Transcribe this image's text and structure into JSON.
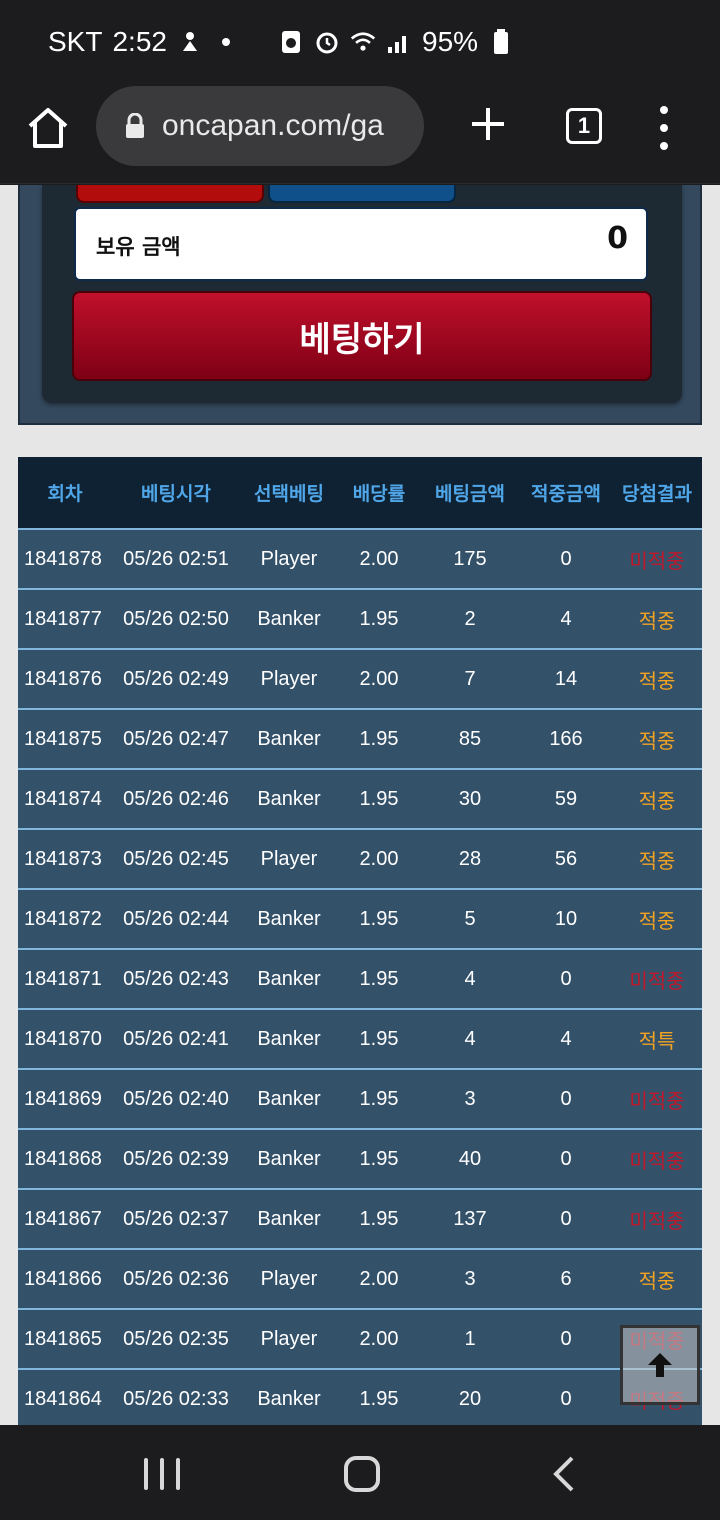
{
  "status_bar": {
    "carrier": "SKT",
    "time": "2:52",
    "battery": "95%"
  },
  "browser": {
    "url": "oncapan.com/ga",
    "tab_count": "1"
  },
  "bet_panel": {
    "balance_label": "보유 금액",
    "balance_value": "0",
    "bet_button_label": "베팅하기"
  },
  "history": {
    "headers": [
      "회차",
      "베팅시각",
      "선택베팅",
      "배당률",
      "베팅금액",
      "적중금액",
      "당첨결과"
    ],
    "rows": [
      {
        "round": "1841878",
        "time": "05/26 02:51",
        "pick": "Player",
        "odds": "2.00",
        "bet": "175",
        "win": "0",
        "result": "미적중",
        "status": "lose"
      },
      {
        "round": "1841877",
        "time": "05/26 02:50",
        "pick": "Banker",
        "odds": "1.95",
        "bet": "2",
        "win": "4",
        "result": "적중",
        "status": "win"
      },
      {
        "round": "1841876",
        "time": "05/26 02:49",
        "pick": "Player",
        "odds": "2.00",
        "bet": "7",
        "win": "14",
        "result": "적중",
        "status": "win"
      },
      {
        "round": "1841875",
        "time": "05/26 02:47",
        "pick": "Banker",
        "odds": "1.95",
        "bet": "85",
        "win": "166",
        "result": "적중",
        "status": "win"
      },
      {
        "round": "1841874",
        "time": "05/26 02:46",
        "pick": "Banker",
        "odds": "1.95",
        "bet": "30",
        "win": "59",
        "result": "적중",
        "status": "win"
      },
      {
        "round": "1841873",
        "time": "05/26 02:45",
        "pick": "Player",
        "odds": "2.00",
        "bet": "28",
        "win": "56",
        "result": "적중",
        "status": "win"
      },
      {
        "round": "1841872",
        "time": "05/26 02:44",
        "pick": "Banker",
        "odds": "1.95",
        "bet": "5",
        "win": "10",
        "result": "적중",
        "status": "win"
      },
      {
        "round": "1841871",
        "time": "05/26 02:43",
        "pick": "Banker",
        "odds": "1.95",
        "bet": "4",
        "win": "0",
        "result": "미적중",
        "status": "lose"
      },
      {
        "round": "1841870",
        "time": "05/26 02:41",
        "pick": "Banker",
        "odds": "1.95",
        "bet": "4",
        "win": "4",
        "result": "적특",
        "status": "win"
      },
      {
        "round": "1841869",
        "time": "05/26 02:40",
        "pick": "Banker",
        "odds": "1.95",
        "bet": "3",
        "win": "0",
        "result": "미적중",
        "status": "lose"
      },
      {
        "round": "1841868",
        "time": "05/26 02:39",
        "pick": "Banker",
        "odds": "1.95",
        "bet": "40",
        "win": "0",
        "result": "미적중",
        "status": "lose"
      },
      {
        "round": "1841867",
        "time": "05/26 02:37",
        "pick": "Banker",
        "odds": "1.95",
        "bet": "137",
        "win": "0",
        "result": "미적중",
        "status": "lose"
      },
      {
        "round": "1841866",
        "time": "05/26 02:36",
        "pick": "Player",
        "odds": "2.00",
        "bet": "3",
        "win": "6",
        "result": "적중",
        "status": "win"
      },
      {
        "round": "1841865",
        "time": "05/26 02:35",
        "pick": "Player",
        "odds": "2.00",
        "bet": "1",
        "win": "0",
        "result": "미적중",
        "status": "lose"
      },
      {
        "round": "1841864",
        "time": "05/26 02:33",
        "pick": "Banker",
        "odds": "1.95",
        "bet": "20",
        "win": "0",
        "result": "미적중",
        "status": "lose"
      }
    ]
  },
  "colors": {
    "win": "#f2a321",
    "lose": "#c0182a",
    "header_text": "#4fa6e8",
    "row_bg": "#34516a"
  }
}
